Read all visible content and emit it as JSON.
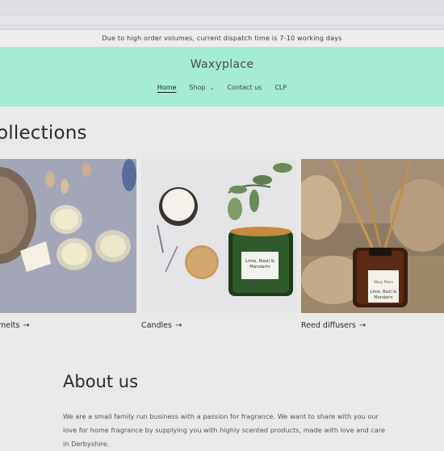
{
  "announcement": "Due to high order volumes, current dispatch time is 7-10 working days",
  "header": {
    "logo": "Waxyplace",
    "nav": [
      {
        "label": "Home",
        "active": true
      },
      {
        "label": "Shop",
        "has_dropdown": true
      },
      {
        "label": "Contact us"
      },
      {
        "label": "CLP"
      }
    ]
  },
  "collections": {
    "title": "ollections",
    "items": [
      {
        "label": "melts"
      },
      {
        "label": "Candles",
        "jar_label": "Lime, Basil & Mandarin",
        "jar_top": "Waxy Place"
      },
      {
        "label": "Reed diffusers",
        "jar_label": "Lime, Basil & Mandarin",
        "jar_top": "Waxy Place"
      }
    ],
    "arrow": "→"
  },
  "about": {
    "title": "About us",
    "text": "We are a small family run business with a passion for fragrance. We want to share with you our love for home fragrance by supplying you with highly scented products, made with love and care in Derbyshire."
  },
  "colors": {
    "header_bg": "#a4ecd3",
    "page_bg": "#e9e9e9"
  }
}
